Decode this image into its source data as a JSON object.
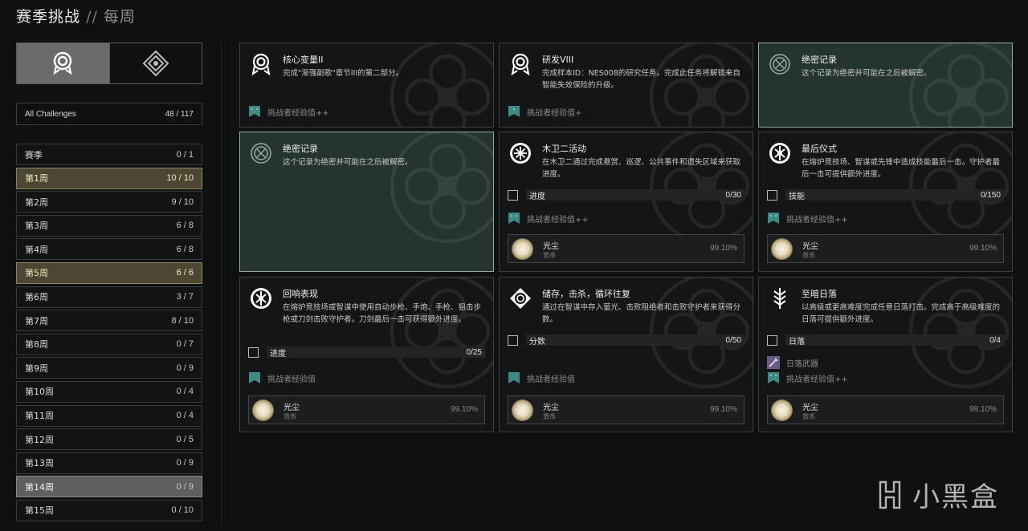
{
  "header": {
    "title": "赛季挑战",
    "separator": "//",
    "subtitle": "每周"
  },
  "sidebar": {
    "tabs": [
      {
        "icon": "seal-icon"
      },
      {
        "icon": "diamond-eye-icon"
      }
    ],
    "all": {
      "label": "All Challenges",
      "count": "48 / 117"
    },
    "items": [
      {
        "label": "赛季",
        "count": "0 / 1",
        "state": "normal"
      },
      {
        "label": "第1周",
        "count": "10 / 10",
        "state": "complete"
      },
      {
        "label": "第2周",
        "count": "9 / 10",
        "state": "normal"
      },
      {
        "label": "第3周",
        "count": "6 / 8",
        "state": "normal"
      },
      {
        "label": "第4周",
        "count": "6 / 8",
        "state": "normal"
      },
      {
        "label": "第5周",
        "count": "6 / 6",
        "state": "complete"
      },
      {
        "label": "第6周",
        "count": "3 / 7",
        "state": "normal"
      },
      {
        "label": "第7周",
        "count": "8 / 10",
        "state": "normal"
      },
      {
        "label": "第8周",
        "count": "0 / 7",
        "state": "normal"
      },
      {
        "label": "第9周",
        "count": "0 / 9",
        "state": "normal"
      },
      {
        "label": "第10周",
        "count": "0 / 4",
        "state": "normal"
      },
      {
        "label": "第11周",
        "count": "0 / 4",
        "state": "normal"
      },
      {
        "label": "第12周",
        "count": "0 / 5",
        "state": "normal"
      },
      {
        "label": "第13周",
        "count": "0 / 9",
        "state": "normal"
      },
      {
        "label": "第14周",
        "count": "0 / 9",
        "state": "selected"
      },
      {
        "label": "第15周",
        "count": "0 / 10",
        "state": "normal"
      }
    ]
  },
  "cards": [
    {
      "title": "核心变量II",
      "desc": "完成\"渐强副歌\"章节III的第二部分。",
      "icon": "seal-icon",
      "secret": false,
      "rewards": [
        {
          "icon": "xp-double-icon",
          "label": "挑战者经验值++"
        }
      ]
    },
    {
      "title": "研发VIII",
      "desc": "完成样本ID：NES008的研究任务。完成此任务将解锁来自智能失效保险的升级。",
      "icon": "seal-icon",
      "secret": false,
      "rewards": [
        {
          "icon": "xp-plus-icon",
          "label": "挑战者经验值+"
        }
      ]
    },
    {
      "title": "绝密记录",
      "desc": "这个记录为绝密并可能在之后被解密。",
      "icon": "classified-icon",
      "secret": true,
      "rewards": []
    },
    {
      "title": "绝密记录",
      "desc": "这个记录为绝密并可能在之后被解密。",
      "icon": "classified-icon",
      "secret": true,
      "rewards": []
    },
    {
      "title": "木卫二活动",
      "desc": "在木卫二通过完成悬赏、巡逻、公共事件和遗失区域来获取进度。",
      "icon": "europa-icon",
      "secret": false,
      "objective": {
        "label": "进度",
        "value": "0/30"
      },
      "rewards": [
        {
          "icon": "xp-double-icon",
          "label": "挑战者经验值++"
        }
      ],
      "dust": {
        "name": "光尘",
        "type": "货币",
        "pct": "99.10%"
      }
    },
    {
      "title": "最后仪式",
      "desc": "在熔炉竞技场、智谋或先锋中造成技能最后一击。守护者最后一击可提供额外进度。",
      "icon": "crucible-icon",
      "secret": false,
      "objective": {
        "label": "技能",
        "value": "0/150"
      },
      "rewards": [
        {
          "icon": "xp-double-icon",
          "label": "挑战者经验值++"
        }
      ],
      "dust": {
        "name": "光尘",
        "type": "货币",
        "pct": "99.10%"
      }
    },
    {
      "title": "回响表现",
      "desc": "在熔炉竞技场或智谋中使用自动步枪、手炮、手枪、狙击步枪或刀剑击败守护者。刀剑最后一击可获得额外进度。",
      "icon": "crucible-icon",
      "secret": false,
      "objective": {
        "label": "进度",
        "value": "0/25"
      },
      "rewards": [
        {
          "icon": "xp-icon",
          "label": "挑战者经验值"
        }
      ],
      "dust": {
        "name": "光尘",
        "type": "货币",
        "pct": "99.10%"
      }
    },
    {
      "title": "储存，击杀，循环往复",
      "desc": "通过在智谋中存入萤光、击败阻绝者和击败守护者来获得分数。",
      "icon": "gambit-icon",
      "secret": false,
      "objective": {
        "label": "分数",
        "value": "0/50"
      },
      "rewards": [
        {
          "icon": "xp-icon",
          "label": "挑战者经验值"
        }
      ],
      "dust": {
        "name": "光尘",
        "type": "货币",
        "pct": "99.10%"
      }
    },
    {
      "title": "至暗日落",
      "desc": "以高级或更高难度完成任意日落打击。完成高于高级难度的日落可提供额外进度。",
      "icon": "vanguard-icon",
      "secret": false,
      "objective": {
        "label": "日落",
        "value": "0/4"
      },
      "rewards": [
        {
          "icon": "weapon-icon",
          "label": "日落武器"
        },
        {
          "icon": "xp-double-icon",
          "label": "挑战者经验值++"
        }
      ],
      "dust": {
        "name": "光尘",
        "type": "货币",
        "pct": "99.10%"
      }
    }
  ],
  "watermark": {
    "text": "小黑盒",
    "icon": "heybox-logo-icon"
  }
}
